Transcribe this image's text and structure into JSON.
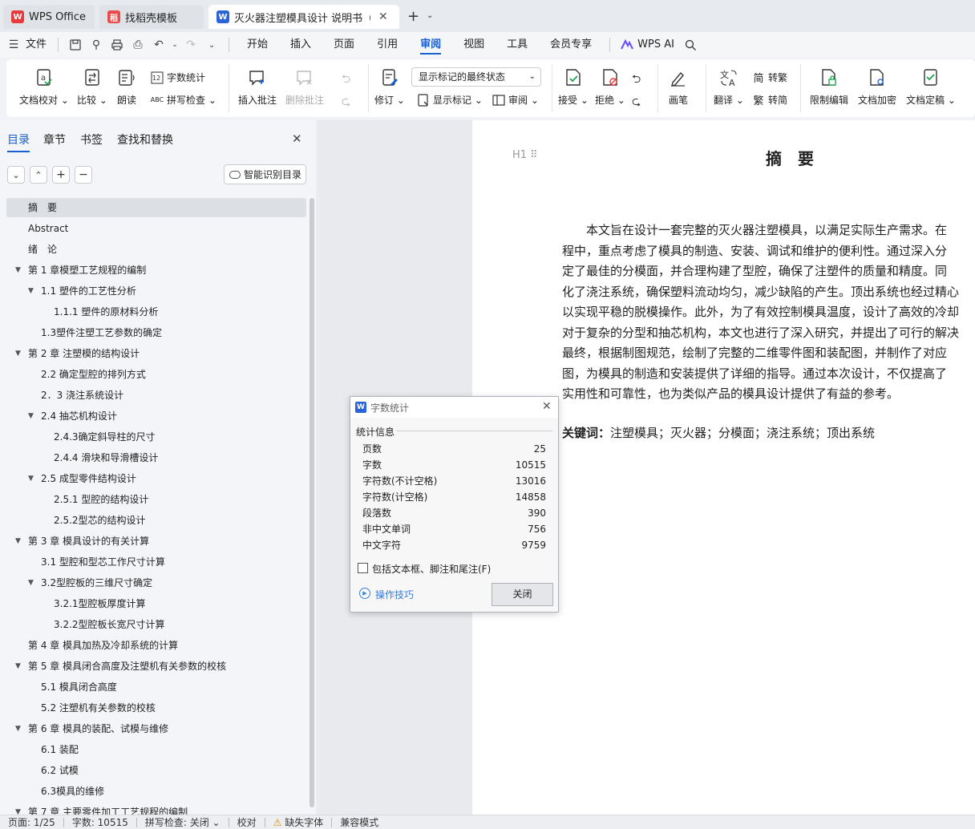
{
  "tabs": [
    {
      "label": "WPS Office",
      "logo": "W",
      "color": "#e83a3a"
    },
    {
      "label": "找稻壳模板",
      "logo": "稻",
      "color": "#e84b4b"
    },
    {
      "label": "灭火器注塑模具设计 说明书（",
      "logo": "W",
      "color": "#2b63d9"
    }
  ],
  "menu": {
    "file": "文件",
    "items": [
      "开始",
      "插入",
      "页面",
      "引用",
      "审阅",
      "视图",
      "工具",
      "会员专享"
    ],
    "active": "审阅",
    "wps_ai": "WPS AI"
  },
  "ribbon": {
    "doc_check": "文档校对",
    "compare": "比较",
    "read_aloud": "朗读",
    "word_count": "字数统计",
    "spell_check": "拼写检查",
    "insert_comment": "插入批注",
    "delete_comment": "删除批注",
    "revise": "修订",
    "markup_state": "显示标记的最终状态",
    "show_markup": "显示标记",
    "review": "审阅",
    "accept": "接受",
    "reject": "拒绝",
    "pen": "画笔",
    "translate": "翻译",
    "to_traditional": "转繁",
    "to_simplified": "转简",
    "restrict_edit": "限制编辑",
    "encrypt": "文档加密",
    "finalize": "文档定稿",
    "trad_glyph": "简",
    "simp_glyph": "繁"
  },
  "nav": {
    "tabs": [
      "目录",
      "章节",
      "书签",
      "查找和替换"
    ],
    "ai_toc": "智能识别目录",
    "toc": [
      {
        "text": "摘　要",
        "level": 1,
        "arrow": false,
        "sel": true
      },
      {
        "text": "Abstract",
        "level": 1,
        "arrow": false
      },
      {
        "text": "绪　论",
        "level": 1,
        "arrow": false
      },
      {
        "text": "第 1 章模塑工艺规程的编制",
        "level": 1,
        "arrow": true
      },
      {
        "text": "1.1  塑件的工艺性分析",
        "level": 2,
        "arrow": true
      },
      {
        "text": "1.1.1    塑件的原材料分析",
        "level": 3,
        "arrow": false
      },
      {
        "text": "1.3塑件注塑工艺参数的确定",
        "level": 2,
        "arrow": false
      },
      {
        "text": "第 2 章  注塑模的结构设计",
        "level": 1,
        "arrow": true
      },
      {
        "text": "2.2  确定型腔的排列方式",
        "level": 2,
        "arrow": false
      },
      {
        "text": "2．3  浇注系统设计",
        "level": 2,
        "arrow": false
      },
      {
        "text": "2.4  抽芯机构设计",
        "level": 2,
        "arrow": true
      },
      {
        "text": "2.4.3确定斜导柱的尺寸",
        "level": 3,
        "arrow": false
      },
      {
        "text": "2.4.4  滑块和导滑槽设计",
        "level": 3,
        "arrow": false
      },
      {
        "text": "2.5  成型零件结构设计",
        "level": 2,
        "arrow": true
      },
      {
        "text": "2.5.1  型腔的结构设计",
        "level": 3,
        "arrow": false
      },
      {
        "text": "2.5.2型芯的结构设计",
        "level": 3,
        "arrow": false
      },
      {
        "text": "第 3 章  模具设计的有关计算",
        "level": 1,
        "arrow": true
      },
      {
        "text": "3.1  型腔和型芯工作尺寸计算",
        "level": 2,
        "arrow": false
      },
      {
        "text": "3.2型腔板的三维尺寸确定",
        "level": 2,
        "arrow": true
      },
      {
        "text": "3.2.1型腔板厚度计算",
        "level": 3,
        "arrow": false
      },
      {
        "text": "3.2.2型腔板长宽尺寸计算",
        "level": 3,
        "arrow": false
      },
      {
        "text": "第 4 章  模具加热及冷却系统的计算",
        "level": 1,
        "arrow": false
      },
      {
        "text": "第 5 章  模具闭合高度及注塑机有关参数的校核",
        "level": 1,
        "arrow": true
      },
      {
        "text": "5.1  模具闭合高度",
        "level": 2,
        "arrow": false
      },
      {
        "text": "5.2  注塑机有关参数的校核",
        "level": 2,
        "arrow": false
      },
      {
        "text": "第 6 章  模具的装配、试模与维修",
        "level": 1,
        "arrow": true
      },
      {
        "text": "6.1  装配",
        "level": 2,
        "arrow": false
      },
      {
        "text": "6.2  试模",
        "level": 2,
        "arrow": false
      },
      {
        "text": "6.3模具的维修",
        "level": 2,
        "arrow": false
      },
      {
        "text": "第 7 章  主要零件加工工艺规程的编制",
        "level": 1,
        "arrow": true
      }
    ]
  },
  "doc": {
    "heading_marker": "H1",
    "title": "摘　要",
    "lines": [
      "　　本文旨在设计一套完整的灭火器注塑模具，以满足实际生产需求。在",
      "程中，重点考虑了模具的制造、安装、调试和维护的便利性。通过深入分",
      "定了最佳的分模面，并合理构建了型腔，确保了注塑件的质量和精度。同",
      "化了浇注系统，确保塑料流动均匀，减少缺陷的产生。顶出系统也经过精心",
      "以实现平稳的脱模操作。此外，为了有效控制模具温度，设计了高效的冷却",
      "对于复杂的分型和抽芯机构，本文也进行了深入研究，并提出了可行的解决",
      "最终，根据制图规范，绘制了完整的二维零件图和装配图，并制作了对应",
      "图，为模具的制造和安装提供了详细的指导。通过本次设计，不仅提高了",
      "实用性和可靠性，也为类似产品的模具设计提供了有益的参考。"
    ],
    "keywords_label": "关键词：",
    "keywords": "注塑模具；灭火器；分模面；浇注系统；顶出系统"
  },
  "dialog": {
    "title": "字数统计",
    "section": "统计信息",
    "stats": [
      {
        "label": "页数",
        "value": "25"
      },
      {
        "label": "字数",
        "value": "10515"
      },
      {
        "label": "字符数(不计空格)",
        "value": "13016"
      },
      {
        "label": "字符数(计空格)",
        "value": "14858"
      },
      {
        "label": "段落数",
        "value": "390"
      },
      {
        "label": "非中文单词",
        "value": "756"
      },
      {
        "label": "中文字符",
        "value": "9759"
      }
    ],
    "include_label": "包括文本框、脚注和尾注(F)",
    "tips": "操作技巧",
    "close": "关闭"
  },
  "status": {
    "page": "页面: 1/25",
    "words": "字数: 10515",
    "spell": "拼写检查: 关闭",
    "proof": "校对",
    "missing_font": "缺失字体",
    "compat": "兼容模式"
  },
  "colors": {
    "accent": "#1a5fd0",
    "brand_red": "#e83a3a"
  }
}
